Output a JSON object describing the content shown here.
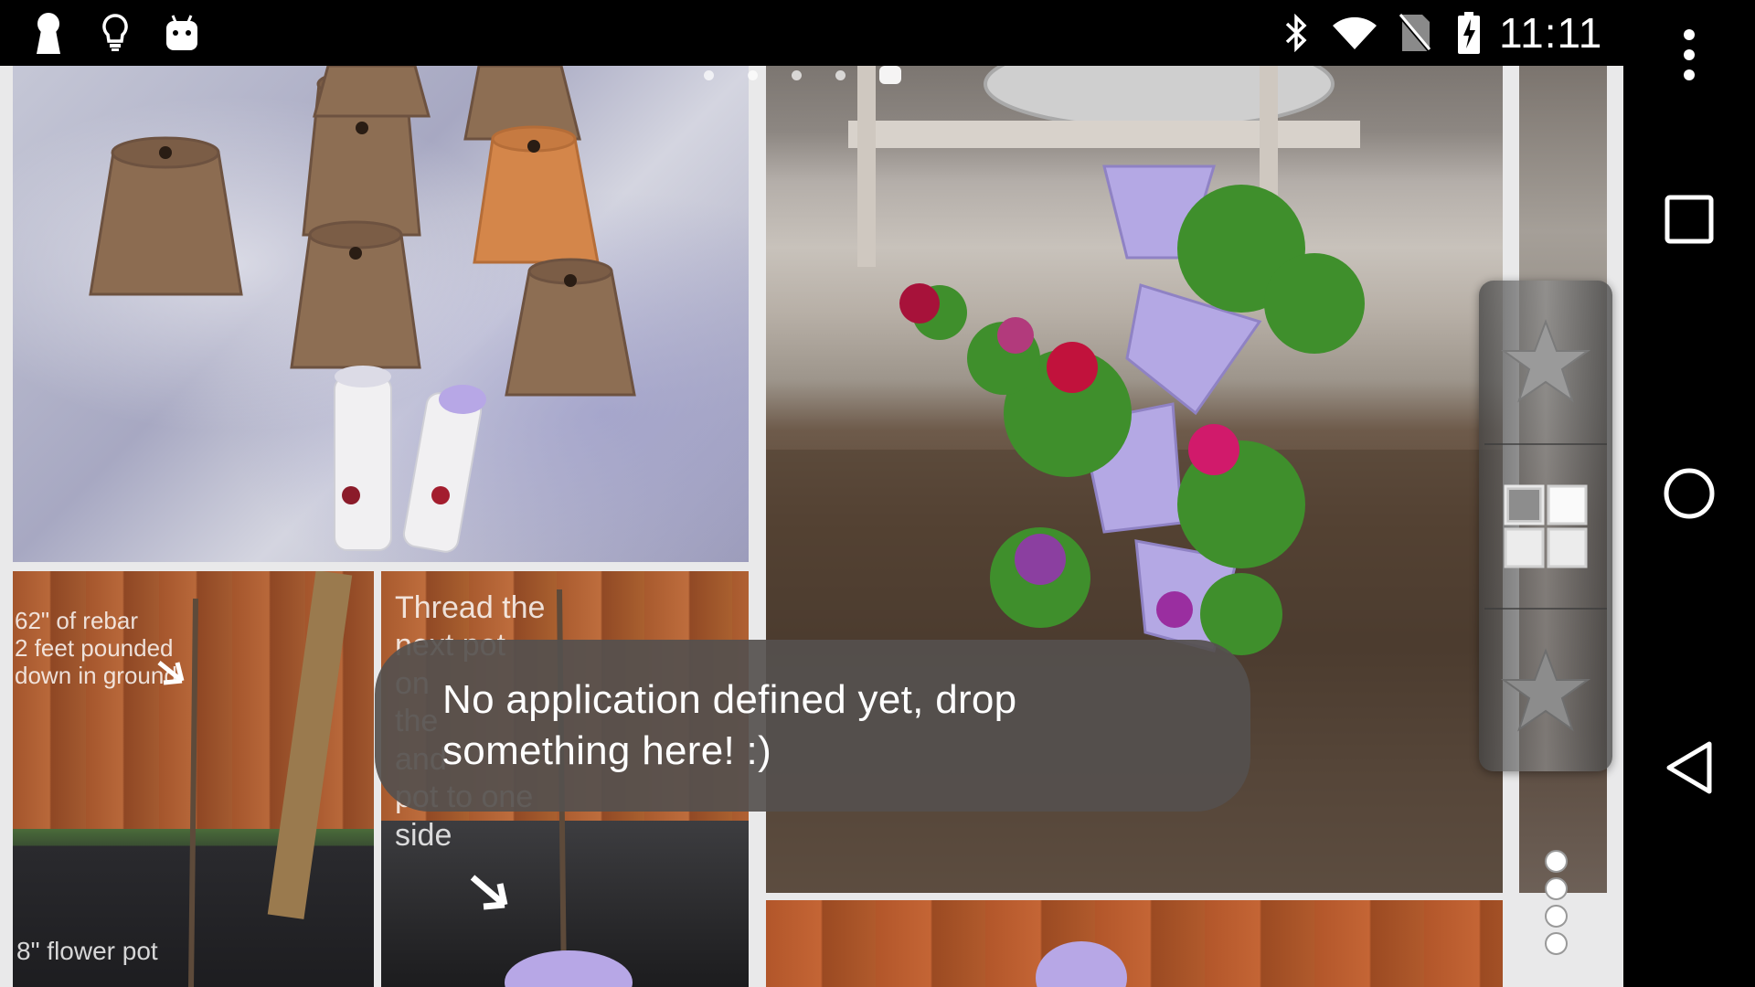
{
  "status_bar": {
    "time": "11:11",
    "left_icons": [
      "keyhole-icon",
      "lightbulb-icon",
      "android-icon"
    ],
    "right_icons": [
      "bluetooth-icon",
      "wifi-icon",
      "no-sim-icon",
      "battery-charging-icon"
    ]
  },
  "nav_bar": {
    "buttons": [
      "overflow-menu",
      "recents",
      "home",
      "back"
    ]
  },
  "dock": {
    "slots": [
      "star-icon",
      "grid-icon",
      "star-icon"
    ]
  },
  "page_indicator": {
    "count": 5,
    "active_index": 4
  },
  "wallpaper": {
    "captions": {
      "rebar": "62\" of rebar\n2 feet pounded\ndown in ground",
      "thread": "Thread the\nnext pot\non\nthe\nand\npot to one\nside",
      "flower_pot": "8\" flower pot"
    }
  },
  "toast": {
    "message": "No application defined yet, drop something here! :)"
  },
  "colors": {
    "status_bar_bg": "#000000",
    "toast_bg": "#55504e",
    "accent_purple": "#b7a7e6"
  }
}
